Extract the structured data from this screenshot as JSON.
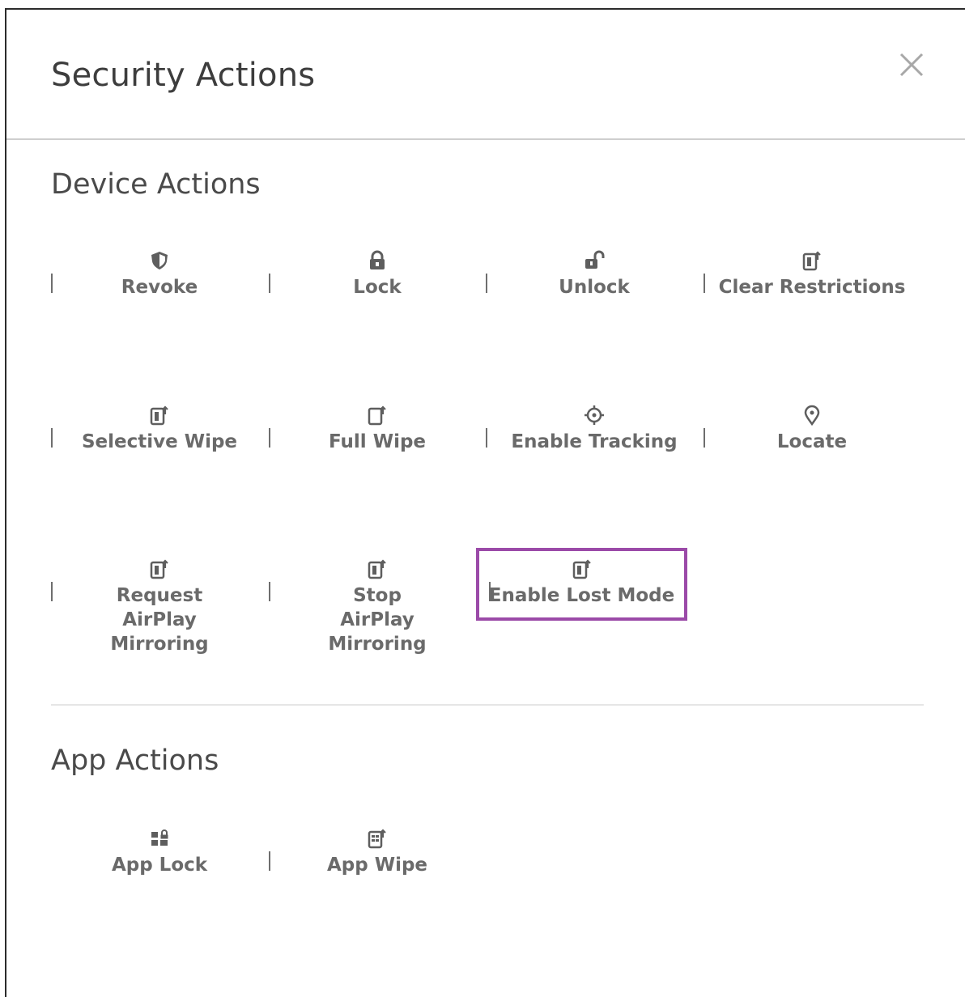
{
  "dialog": {
    "title": "Security Actions",
    "close_icon": "close-icon"
  },
  "device_actions": {
    "title": "Device Actions",
    "items": [
      {
        "label": "Revoke",
        "icon": "shield-icon"
      },
      {
        "label": "Lock",
        "icon": "lock-icon"
      },
      {
        "label": "Unlock",
        "icon": "unlock-icon"
      },
      {
        "label": "Clear Restrictions",
        "icon": "device-arrow-icon"
      },
      {
        "label": "Selective Wipe",
        "icon": "device-arrow-icon"
      },
      {
        "label": "Full Wipe",
        "icon": "device-outline-arrow-icon"
      },
      {
        "label": "Enable Tracking",
        "icon": "crosshair-icon"
      },
      {
        "label": "Locate",
        "icon": "location-pin-icon"
      },
      {
        "label": "Request AirPlay Mirroring",
        "icon": "device-arrow-icon"
      },
      {
        "label": "Stop AirPlay Mirroring",
        "icon": "device-arrow-icon"
      },
      {
        "label": "Enable Lost Mode",
        "icon": "device-arrow-icon"
      }
    ]
  },
  "app_actions": {
    "title": "App Actions",
    "items": [
      {
        "label": "App Lock",
        "icon": "app-grid-lock-icon"
      },
      {
        "label": "App Wipe",
        "icon": "app-wipe-icon"
      }
    ]
  },
  "colors": {
    "highlight_border": "#9b4aa8",
    "text": "#6a6a6a",
    "title": "#3d3d3d"
  }
}
